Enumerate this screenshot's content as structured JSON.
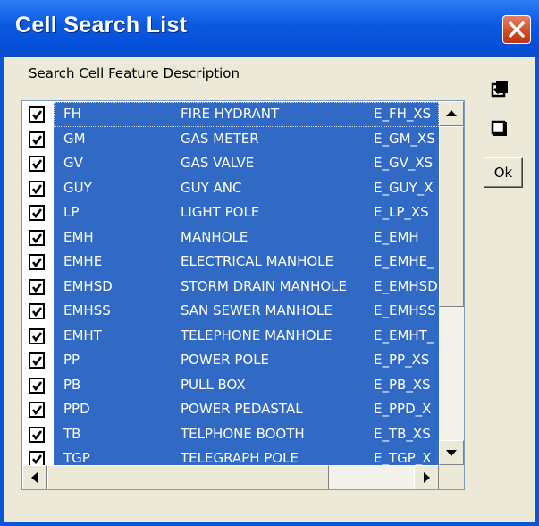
{
  "window": {
    "title": "Cell Search List",
    "close_icon": "close-icon"
  },
  "search": {
    "label": "Search Cell Feature Description"
  },
  "list": {
    "rows": [
      {
        "checked": true,
        "code": "FH",
        "description": "FIRE HYDRANT",
        "cell": "E_FH_XS"
      },
      {
        "checked": true,
        "code": "GM",
        "description": "GAS METER",
        "cell": "E_GM_XS"
      },
      {
        "checked": true,
        "code": "GV",
        "description": "GAS VALVE",
        "cell": "E_GV_XS"
      },
      {
        "checked": true,
        "code": "GUY",
        "description": "GUY ANC",
        "cell": "E_GUY_X"
      },
      {
        "checked": true,
        "code": "LP",
        "description": "LIGHT POLE",
        "cell": "E_LP_XS"
      },
      {
        "checked": true,
        "code": "EMH",
        "description": "MANHOLE",
        "cell": "E_EMH"
      },
      {
        "checked": true,
        "code": "EMHE",
        "description": "ELECTRICAL MANHOLE",
        "cell": "E_EMHE_"
      },
      {
        "checked": true,
        "code": "EMHSD",
        "description": "STORM DRAIN MANHOLE",
        "cell": "E_EMHSD"
      },
      {
        "checked": true,
        "code": "EMHSS",
        "description": "SAN SEWER MANHOLE",
        "cell": "E_EMHSS"
      },
      {
        "checked": true,
        "code": "EMHT",
        "description": "TELEPHONE MANHOLE",
        "cell": "E_EMHT_"
      },
      {
        "checked": true,
        "code": "PP",
        "description": "POWER POLE",
        "cell": "E_PP_XS"
      },
      {
        "checked": true,
        "code": "PB",
        "description": "PULL BOX",
        "cell": "E_PB_XS"
      },
      {
        "checked": true,
        "code": "PPD",
        "description": "POWER PEDASTAL",
        "cell": "E_PPD_X"
      },
      {
        "checked": true,
        "code": "TB",
        "description": "TELPHONE BOOTH",
        "cell": "E_TB_XS"
      },
      {
        "checked": true,
        "code": "TGP",
        "description": "TELEGRAPH POLE",
        "cell": "E_TGP_X"
      }
    ]
  },
  "side": {
    "select_all_icon": "check-all-icon",
    "clear_all_icon": "uncheck-all-icon",
    "ok_label": "Ok"
  },
  "colors": {
    "selection": "#316ac5",
    "titlebar": "#0a58e2",
    "dialog_face": "#ece9d8"
  }
}
